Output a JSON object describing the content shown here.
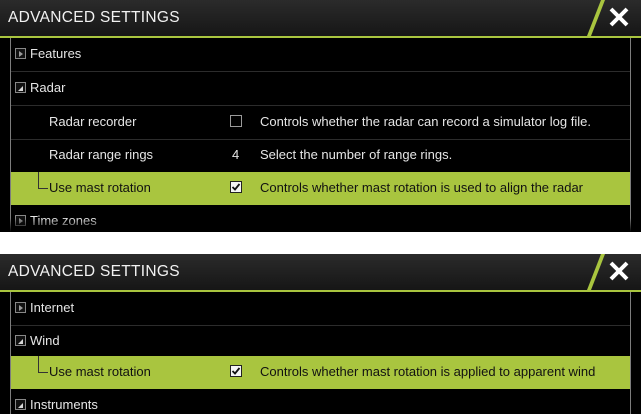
{
  "colors": {
    "accent": "#a9c53f",
    "background": "#000000",
    "close_icon": "#ffffff"
  },
  "panel1": {
    "title": "ADVANCED SETTINGS",
    "rows": [
      {
        "label": "Features",
        "expander": "collapsed"
      },
      {
        "label": "Radar",
        "expander": "expanded"
      },
      {
        "label": "Radar recorder",
        "checked": false,
        "description": "Controls whether the radar can record a simulator log file."
      },
      {
        "label": "Radar range rings",
        "value": "4",
        "description": "Select the number of range rings."
      },
      {
        "label": "Use mast rotation",
        "checked": true,
        "selected": true,
        "description": "Controls whether mast rotation is used to align the radar"
      },
      {
        "label": "Time zones",
        "expander": "collapsed"
      }
    ]
  },
  "panel2": {
    "title": "ADVANCED SETTINGS",
    "rows": [
      {
        "label": "Internet",
        "expander": "collapsed"
      },
      {
        "label": "Wind",
        "expander": "expanded"
      },
      {
        "label": "Use mast rotation",
        "checked": true,
        "selected": true,
        "description": "Controls whether mast rotation is applied to apparent wind"
      },
      {
        "label": "Instruments",
        "expander": "expanded"
      }
    ]
  }
}
